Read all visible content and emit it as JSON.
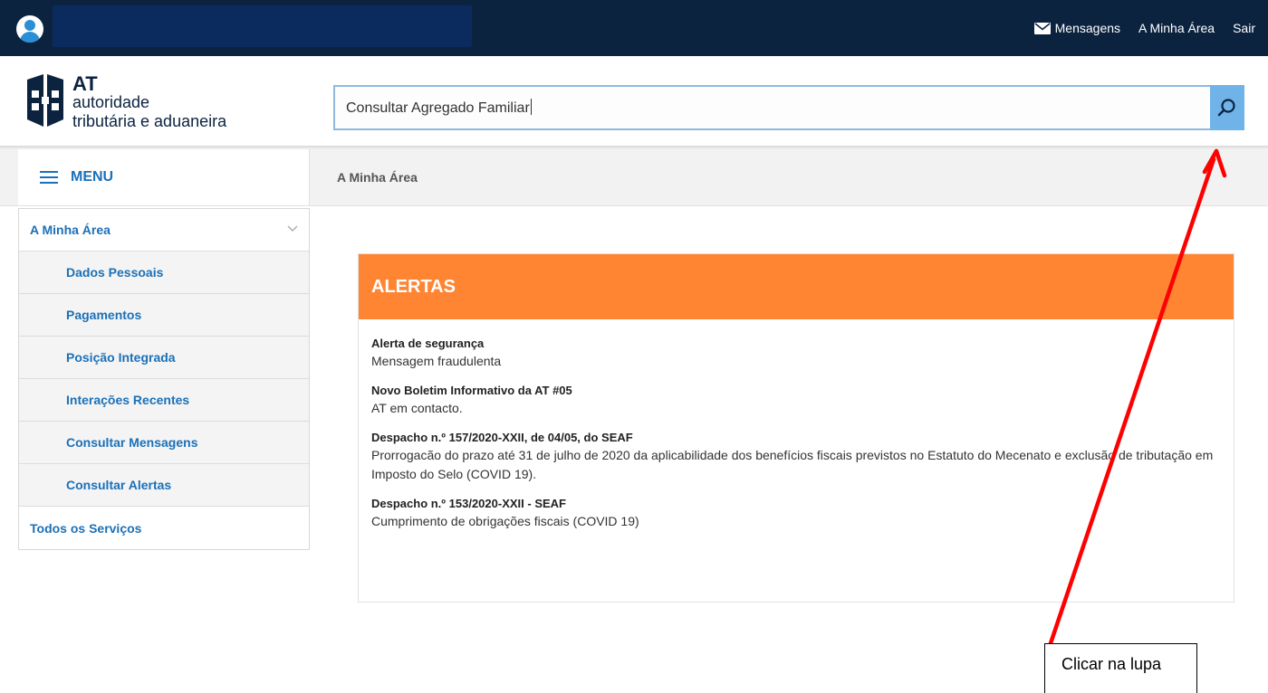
{
  "topbar": {
    "links": [
      {
        "label": "Mensagens",
        "icon": "envelope-icon"
      },
      {
        "label": "A Minha Área"
      },
      {
        "label": "Sair"
      }
    ]
  },
  "logo": {
    "abbr": "AT",
    "line1": "autoridade",
    "line2": "tributária e aduaneira"
  },
  "search": {
    "value": "Consultar Agregado Familiar",
    "icon": "search-icon",
    "button_color": "#6fb3e8"
  },
  "menu": {
    "title": "MENU",
    "icon": "hamburger-icon"
  },
  "breadcrumb": "A Minha Área",
  "sidebar": {
    "items": [
      {
        "label": "A Minha Área",
        "level": "top",
        "expanded": true
      },
      {
        "label": "Dados Pessoais",
        "level": "sub"
      },
      {
        "label": "Pagamentos",
        "level": "sub"
      },
      {
        "label": "Posição Integrada",
        "level": "sub"
      },
      {
        "label": "Interações Recentes",
        "level": "sub"
      },
      {
        "label": "Consultar Mensagens",
        "level": "sub"
      },
      {
        "label": "Consultar Alertas",
        "level": "sub"
      },
      {
        "label": "Todos os Serviços",
        "level": "top"
      }
    ]
  },
  "alerts": {
    "title": "ALERTAS",
    "header_color": "#ff8533",
    "items": [
      {
        "title": "Alerta de segurança",
        "text": "Mensagem fraudulenta"
      },
      {
        "title": "Novo Boletim Informativo da AT #05",
        "text": "AT em contacto."
      },
      {
        "title": "Despacho n.º 157/2020-XXII, de 04/05, do SEAF",
        "text": "Prorrogacão do prazo até 31 de julho de 2020 da aplicabilidade dos benefícios fiscais previstos no Estatuto do Mecenato e exclusão de tributação em Imposto do Selo (COVID 19)."
      },
      {
        "title": "Despacho n.º 153/2020-XXII - SEAF",
        "text": "Cumprimento de obrigações fiscais (COVID 19)"
      }
    ]
  },
  "annotation": {
    "text": "Clicar na lupa",
    "arrow_color": "#ff0000"
  },
  "colors": {
    "topbar": "#0c2340",
    "link_blue": "#1b70b8",
    "accent_orange": "#ff8533"
  }
}
